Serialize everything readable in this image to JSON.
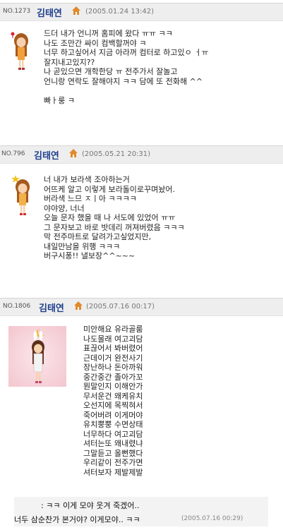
{
  "posts": [
    {
      "no": "NO.1273",
      "author": "김태연",
      "date": "(2005.01.24 13:42)",
      "lines": [
        "드더 내가 언니꺼 홈피에 왔다 ㅠㅠ ㅋㅋ",
        "나도 조만간 싸이 컴백할꺼야 ㅋ",
        "너무 하고싶어서 지금 아라꺼 컴터로 하고있ㅇ ㅓㅠ",
        "잘지내고있지??",
        "나 곧있으면 개학한당 ㅠ 전주가서 잘놀고",
        "언니랑 연락도 잘해야지 ㅋㅋ 담에 또 전화해 ^^",
        "",
        "빠ㅏ룽 ㅋ"
      ]
    },
    {
      "no": "NO.796",
      "author": "김태연",
      "date": "(2005.05.21 20:31)",
      "lines": [
        "너 내가 보라색 조아하는거",
        "어뜨케 알고 이렇게 보라돌이로꾸며놨어.",
        "버라색 느므 ㅈㅣ아 ㅋㅋㅋㅋ",
        "야야양, 너너",
        "오늘 문자 했을 때 나 서도에 있었어 ㅠㅠ",
        "그 문자보고 바로 밧데리 꺼져버렸음 ㅋㅋㅋ",
        "막 전주마트로 달려가고싶었지만,",
        "내일만남을 위행 ㅋㅋㅋ",
        "버구시퐁!! 낼보장^^~~~"
      ]
    },
    {
      "no": "NO.1806",
      "author": "김태연",
      "date": "(2005.07.16 00:17)",
      "lines": [
        "미안해요 유라골룸",
        "나도몰래 여고괴담",
        "표끊어서 봐버렸어",
        "근데이거 완전사기",
        "장난하나 돈아까워",
        "중간중간 졸아가꼬",
        "뭔말인지 이해안가",
        "무서운건 왜케유치",
        "오선지에 목찍혀서",
        "죽어버려 이게머야",
        "유치뿡뿡 수면상태",
        "너무하다 여고괴담",
        "셔터는또 왜내렸냐",
        "그말듣고 올뻔했다",
        "우리같이 전주가면",
        "셔터보자 제발제발"
      ],
      "comments": [
        {
          "text": ": ㅋㅋ 이게 모야 웃겨 죽겠어..",
          "date": ""
        },
        {
          "text": "너두 삼순찬가 본거야? 이게모야.. ㅋㅋ",
          "date": "(2005.07.16 00:29)"
        }
      ]
    }
  ],
  "colors": {
    "header_bg": "#eeeeee",
    "author": "#1e3f8f",
    "home_icon": "#e08a2c"
  }
}
